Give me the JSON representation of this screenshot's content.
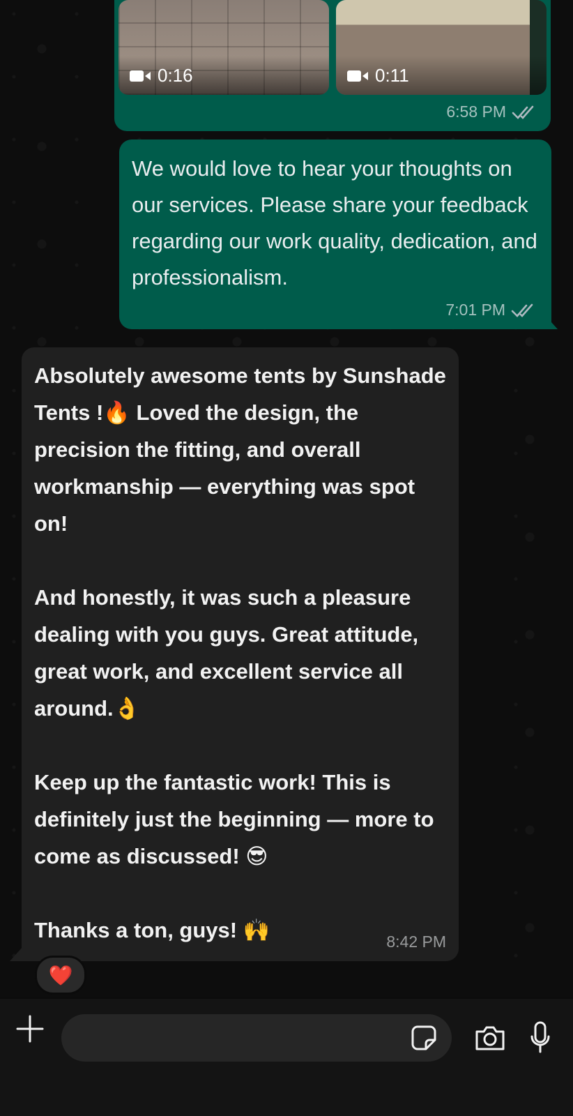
{
  "chat": {
    "media_message": {
      "videos": [
        {
          "duration": "0:16"
        },
        {
          "duration": "0:11"
        }
      ],
      "time": "6:58 PM",
      "status": "read"
    },
    "outgoing_message": {
      "text": "We would love to hear your thoughts on our services. Please share your feedback regarding our work quality, dedication, and professionalism.",
      "time": "7:01 PM",
      "status": "read"
    },
    "incoming_message": {
      "text": "Absolutely awesome tents by Sunshade Tents !🔥 Loved the design, the precision the fitting, and overall workmanship — everything was spot on!\n\nAnd honestly, it was such a pleasure dealing with you guys. Great attitude, great work, and excellent service all around.👌\n\nKeep up the fantastic work! This is definitely just the beginning — more to come as discussed! 😎\n\nThanks a ton, guys! 🙌",
      "time": "8:42 PM",
      "reaction": "❤️"
    }
  },
  "composer": {
    "message_value": "",
    "icons": [
      "plus-icon",
      "sticker-icon",
      "camera-icon",
      "microphone-icon"
    ]
  },
  "colors": {
    "outgoing_bubble": "#005c4b",
    "incoming_bubble": "#202020",
    "background": "#0d0d0d"
  }
}
